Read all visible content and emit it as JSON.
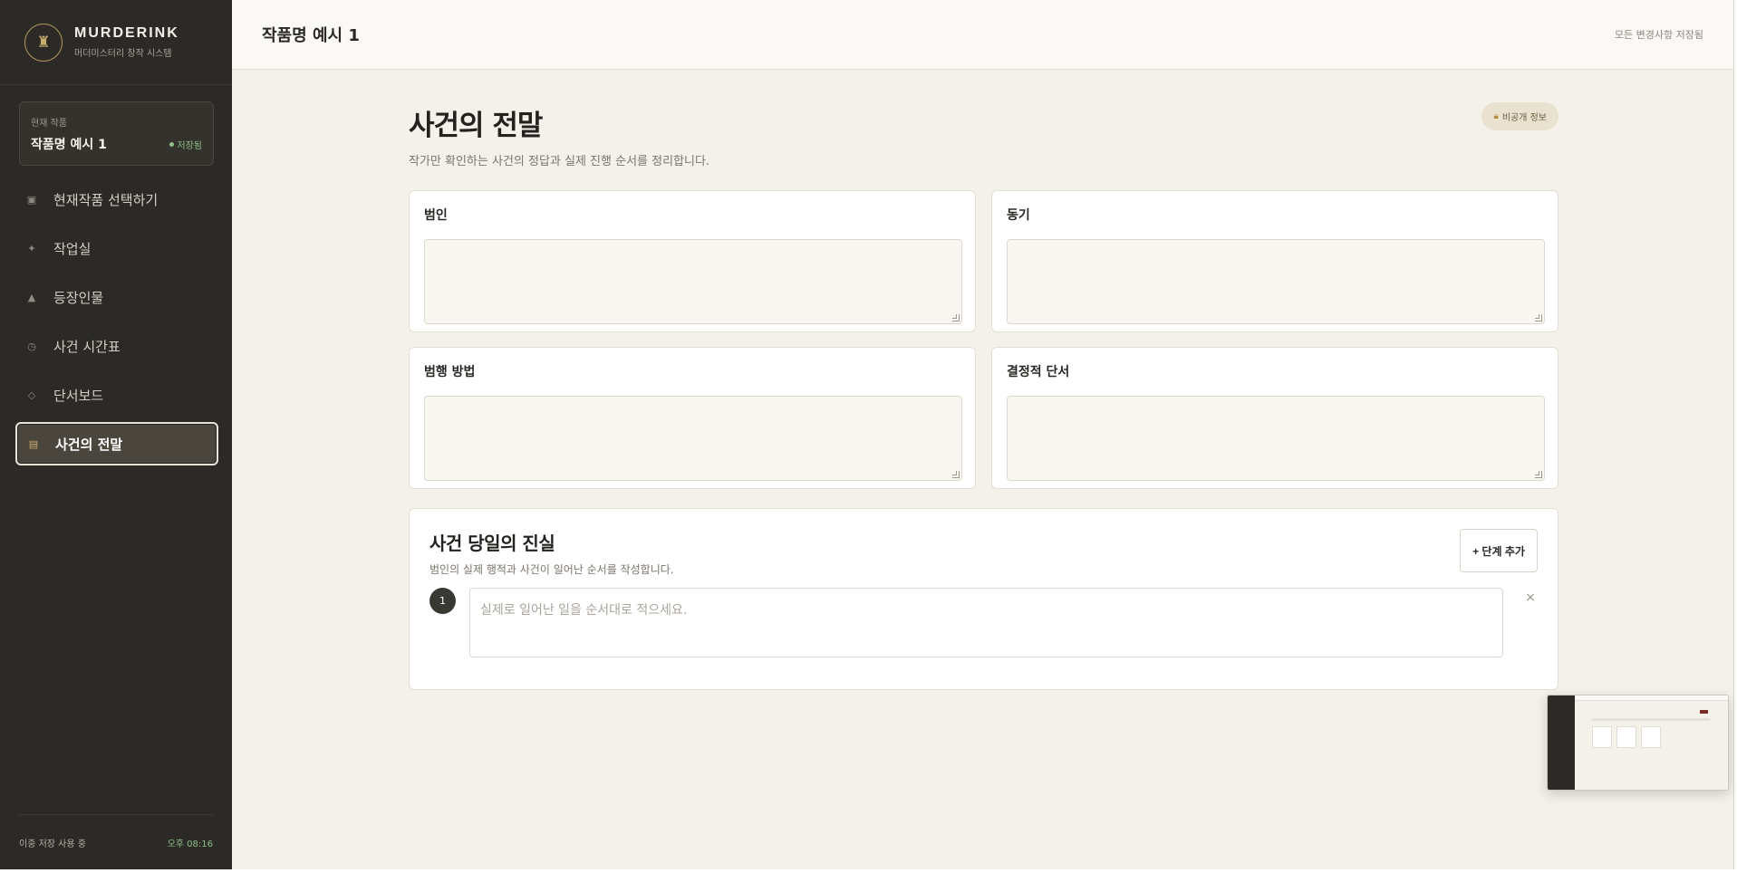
{
  "colors": {
    "sidebar_bg": "#2b2a26",
    "main_bg": "#f4f1ea",
    "accent_gold": "#c9ae70",
    "saved_green": "#8fbf8a",
    "step_badge": "#3a3833"
  },
  "brand": {
    "logo_icon": "rook-icon",
    "logo_glyph": "♜",
    "name": "MURDERINK",
    "subtitle": "머더미스터리 창작 시스템"
  },
  "current_work": {
    "label": "현재 작품",
    "title": "작품명 예시 1",
    "status": "저장됨"
  },
  "nav": {
    "items": [
      {
        "icon": "square-icon",
        "glyph": "▣",
        "label": "현재작품 선택하기"
      },
      {
        "icon": "sparkle-icon",
        "glyph": "✦",
        "label": "작업실"
      },
      {
        "icon": "person-icon",
        "glyph": "▲",
        "label": "등장인물"
      },
      {
        "icon": "clock-icon",
        "glyph": "◷",
        "label": "사건 시간표"
      },
      {
        "icon": "diamond-icon",
        "glyph": "◇",
        "label": "단서보드"
      },
      {
        "icon": "list-icon",
        "glyph": "▤",
        "label": "사건의 전말"
      }
    ],
    "active_index": 5
  },
  "footer": {
    "storage": "이중 저장 사용 중",
    "ampm": "오후",
    "time": "08:16"
  },
  "topbar": {
    "title": "작품명 예시 1",
    "status": "모든 변경사항 저장됨"
  },
  "page": {
    "title": "사건의 전말",
    "description": "작가만 확인하는 사건의 정답과 실제 진행 순서를 정리합니다.",
    "private_badge": "비공개 정보",
    "private_icon": "lock-icon"
  },
  "fields": [
    {
      "label": "범인",
      "value": ""
    },
    {
      "label": "동기",
      "value": ""
    },
    {
      "label": "범행 방법",
      "value": ""
    },
    {
      "label": "결정적 단서",
      "value": ""
    }
  ],
  "truth": {
    "title": "사건 당일의 진실",
    "description": "범인의 실제 행적과 사건이 일어난 순서를 작성합니다.",
    "add_button": "+ 단계 추가",
    "steps": [
      {
        "number": "1",
        "placeholder": "실제로 일어난 일을 순서대로 적으세요.",
        "remove": "×"
      }
    ]
  }
}
